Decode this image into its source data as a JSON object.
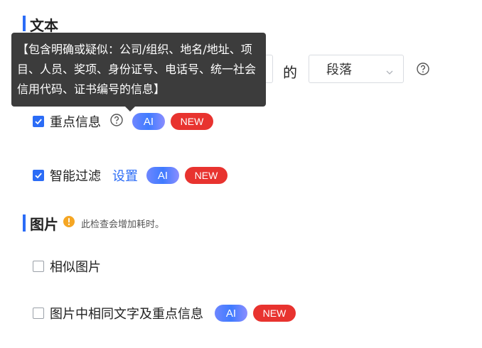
{
  "text_section": {
    "title": "文本",
    "select_suffix": "的",
    "scope_select": {
      "value": "段落"
    }
  },
  "tooltip": {
    "text": "【包含明确或疑似：公司/组织、地名/地址、项目、人员、奖项、身份证号、电话号、统一社会信用代码、证书编号的信息】"
  },
  "options": {
    "key_info": {
      "label": "重点信息",
      "checked": true,
      "ai": "AI",
      "new": "NEW"
    },
    "smart_filter": {
      "label": "智能过滤",
      "checked": true,
      "link": "设置",
      "ai": "AI",
      "new": "NEW"
    }
  },
  "image_section": {
    "title": "图片",
    "note": "此检查会增加耗时。",
    "similar_images": {
      "label": "相似图片",
      "checked": false
    },
    "same_text": {
      "label": "图片中相同文字及重点信息",
      "checked": false,
      "ai": "AI",
      "new": "NEW"
    }
  },
  "colors": {
    "accent": "#2b6cf6",
    "new": "#e8332f",
    "warning": "#f5a623",
    "tooltip_bg": "#3c3c3c"
  }
}
